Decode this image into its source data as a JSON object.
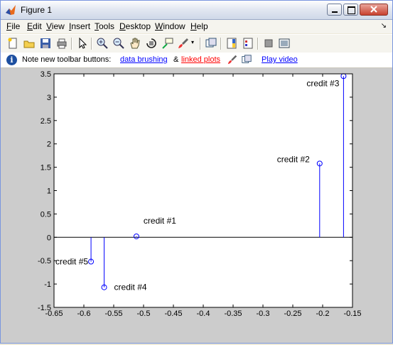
{
  "window": {
    "title": "Figure 1"
  },
  "menu": [
    {
      "label": "File",
      "key": "F"
    },
    {
      "label": "Edit",
      "key": "E"
    },
    {
      "label": "View",
      "key": "V"
    },
    {
      "label": "Insert",
      "key": "I"
    },
    {
      "label": "Tools",
      "key": "T"
    },
    {
      "label": "Desktop",
      "key": "D"
    },
    {
      "label": "Window",
      "key": "W"
    },
    {
      "label": "Help",
      "key": "H"
    }
  ],
  "toolbar_icons": [
    "new-figure-icon",
    "open-file-icon",
    "save-icon",
    "print-icon",
    "pointer-icon",
    "zoom-in-icon",
    "zoom-out-icon",
    "pan-icon",
    "rotate-3d-icon",
    "data-cursor-icon",
    "brush-icon",
    "link-plot-icon",
    "colorbar-icon",
    "legend-icon",
    "hide-plot-tools-icon",
    "show-plot-tools-icon"
  ],
  "infobar": {
    "note": "Note new toolbar buttons:",
    "link1": "data brushing",
    "amp": "&",
    "link2": "linked plots",
    "video": "Play video"
  },
  "colors": {
    "stem": "#0000ff",
    "axes_bg": "#ffffff",
    "figure_bg": "#cccccc",
    "link": "#0000ff",
    "link_red": "#ff0000"
  },
  "chart_data": {
    "type": "scatter",
    "style": "stem",
    "xlim": [
      -0.65,
      -0.15
    ],
    "ylim": [
      -1.5,
      3.5
    ],
    "xticks": [
      -0.65,
      -0.6,
      -0.55,
      -0.5,
      -0.45,
      -0.4,
      -0.35,
      -0.3,
      -0.25,
      -0.2,
      -0.15
    ],
    "yticks": [
      -1.5,
      -1,
      -0.5,
      0,
      0.5,
      1,
      1.5,
      2,
      2.5,
      3,
      3.5
    ],
    "xticklabels": [
      "-0.65",
      "-0.6",
      "-0.55",
      "-0.5",
      "-0.45",
      "-0.4",
      "-0.35",
      "-0.3",
      "-0.25",
      "-0.2",
      "-0.15"
    ],
    "yticklabels": [
      "-1.5",
      "-1",
      "-0.5",
      "0",
      "0.5",
      "1",
      "1.5",
      "2",
      "2.5",
      "3",
      "3.5"
    ],
    "points": [
      {
        "x": -0.512,
        "y": 0.02,
        "label": "credit #1"
      },
      {
        "x": -0.205,
        "y": 1.58,
        "label": "credit #2"
      },
      {
        "x": -0.165,
        "y": 3.45,
        "label": "credit #3"
      },
      {
        "x": -0.566,
        "y": -1.07,
        "label": "credit #4"
      },
      {
        "x": -0.588,
        "y": -0.52,
        "label": "credit #5"
      }
    ]
  }
}
